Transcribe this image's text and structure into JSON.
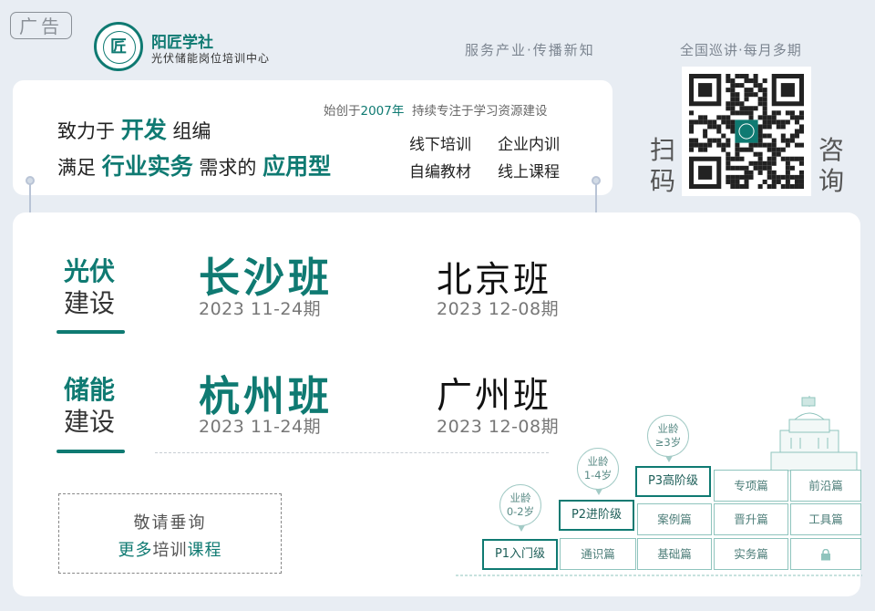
{
  "ad_label": "广告",
  "brand": {
    "name": "阳匠学社",
    "subtitle": "光伏储能岗位培训中心",
    "logo_glyph": "匠"
  },
  "header": {
    "slogan_left": "服务产业·传播新知",
    "slogan_right": "全国巡讲·每月多期"
  },
  "qr": {
    "scan_left": [
      "扫",
      "码"
    ],
    "scan_right": [
      "咨",
      "询"
    ]
  },
  "intro": {
    "line1": {
      "pre": "致力于",
      "hl": "开发",
      "post": "组编"
    },
    "line2": {
      "pre": "满足",
      "hl": "行业实务",
      "mid": "需求的",
      "hl2": "应用型"
    },
    "since": {
      "pre": "始创于",
      "year": "2007年",
      "post": "持续专注于学习资源建设"
    },
    "services": [
      "线下培训",
      "企业内训",
      "自编教材",
      "线上课程"
    ]
  },
  "categories": [
    {
      "line1": "光伏",
      "line2": "建设",
      "classes": [
        {
          "name": "长沙班",
          "period": "2023 11-24期"
        },
        {
          "name": "北京班",
          "period": "2023 12-08期"
        }
      ]
    },
    {
      "line1": "储能",
      "line2": "建设",
      "classes": [
        {
          "name": "杭州班",
          "period": "2023 11-24期"
        },
        {
          "name": "广州班",
          "period": "2023 12-08期"
        }
      ]
    }
  ],
  "more": {
    "line1": "敬请垂询",
    "line2_pre": "更多",
    "line2_mid": "培训",
    "line2_post": "课程"
  },
  "staircase": {
    "levels": [
      "P1入门级",
      "P2进阶级",
      "P3高阶级"
    ],
    "bubbles": [
      "业龄 0-2岁",
      "业龄 1-4岁",
      "业龄 ≥3岁"
    ],
    "bubble_lines": [
      [
        "业龄",
        "0-2岁"
      ],
      [
        "业龄",
        "1-4岁"
      ],
      [
        "业龄",
        "≥3岁"
      ]
    ],
    "courses": [
      "通识篇",
      "基础篇",
      "实务篇",
      "案例篇",
      "晋升篇",
      "工具篇",
      "专项篇",
      "前沿篇"
    ],
    "lock_icon": "lock-icon"
  },
  "colors": {
    "accent": "#0f7a72",
    "background": "#e8edf3"
  }
}
